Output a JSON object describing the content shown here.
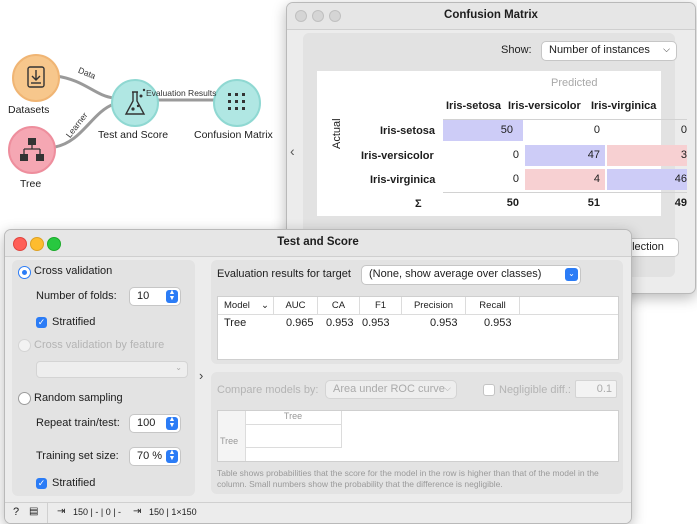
{
  "workflow": {
    "nodes": [
      {
        "label": "Datasets",
        "icon": "datasets-icon",
        "color": "#f7c78c"
      },
      {
        "label": "Tree",
        "icon": "tree-icon",
        "color": "#f5a7b3"
      },
      {
        "label": "Test and Score",
        "icon": "flask-icon",
        "color": "#b0e7e3"
      },
      {
        "label": "Confusion Matrix",
        "icon": "matrix-icon",
        "color": "#b0e7e3"
      }
    ],
    "links": [
      "Data",
      "Learner",
      "Evaluation Results"
    ]
  },
  "confusion_matrix": {
    "title": "Confusion Matrix",
    "show_label": "Show:",
    "show_value": "Number of instances",
    "predicted_label": "Predicted",
    "actual_label": "Actual",
    "classes": [
      "Iris-setosa",
      "Iris-versicolor",
      "Iris-virginica"
    ],
    "rows": [
      [
        "50",
        "0",
        "0"
      ],
      [
        "0",
        "47",
        "3"
      ],
      [
        "0",
        "4",
        "46"
      ]
    ],
    "sum_symbol": "Σ",
    "column_sums": [
      "50",
      "51",
      "49"
    ],
    "partial_button": "election",
    "colors": {
      "diag": "#cdccf7",
      "err": "#f7d0d2",
      "diag_strong": "#c2c1f5"
    }
  },
  "test_and_score": {
    "title": "Test and Score",
    "cross_validation": "Cross validation",
    "folds_label": "Number of folds:",
    "folds_value": "10",
    "stratified": "Stratified",
    "cv_by_feature": "Cross validation by feature",
    "random_sampling": "Random sampling",
    "repeat_label": "Repeat train/test:",
    "repeat_value": "100",
    "training_label": "Training set size:",
    "training_value": "70 %",
    "stratified2": "Stratified",
    "eval_target_label": "Evaluation results for target",
    "eval_target_value": "(None, show average over classes)",
    "columns": [
      "Model",
      "AUC",
      "CA",
      "F1",
      "Precision",
      "Recall"
    ],
    "rows": [
      {
        "model": "Tree",
        "auc": "0.965",
        "ca": "0.953",
        "f1": "0.953",
        "precision": "0.953",
        "recall": "0.953"
      }
    ],
    "compare_label": "Compare models by:",
    "compare_value": "Area under ROC curve",
    "negligible_label": "Negligible diff.:",
    "negligible_value": "0.1",
    "compare_column": "Tree",
    "compare_row": "Tree",
    "footnote": "Table shows probabilities that the score for the model in the row is higher than that of the model in the column. Small numbers show the probability that the difference is negligible.",
    "status": {
      "input": "150 | - | 0 | -",
      "output": "150 | 1×150"
    }
  }
}
